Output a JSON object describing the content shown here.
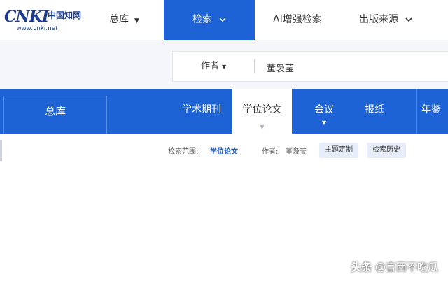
{
  "logo": {
    "brand": "CNKI",
    "chinese": "中国知网",
    "url": "www.cnki.net"
  },
  "topnav": {
    "zongku": "总库",
    "jiansuo": "检索",
    "ai_search": "AI增强检索",
    "chuban": "出版来源"
  },
  "search": {
    "field": "作者",
    "query": "董袅莹"
  },
  "db_tabs": {
    "zongku": "总库",
    "items": [
      {
        "label": "学术期刊"
      },
      {
        "label": "学位论文",
        "active": true
      },
      {
        "label": "会议"
      },
      {
        "label": "报纸"
      },
      {
        "label": "年鉴"
      }
    ]
  },
  "crumbs": {
    "scope_label": "检索范围:",
    "scope_value": "学位论文",
    "author_label": "作者:",
    "author_value": "董袅莹",
    "topic_button": "主题定制",
    "history_button": "检索历史"
  },
  "watermark": {
    "platform": "头条",
    "handle": "@言西不吃瓜"
  },
  "colors": {
    "accent": "#1e63d5",
    "logo": "#1c3b8c"
  }
}
